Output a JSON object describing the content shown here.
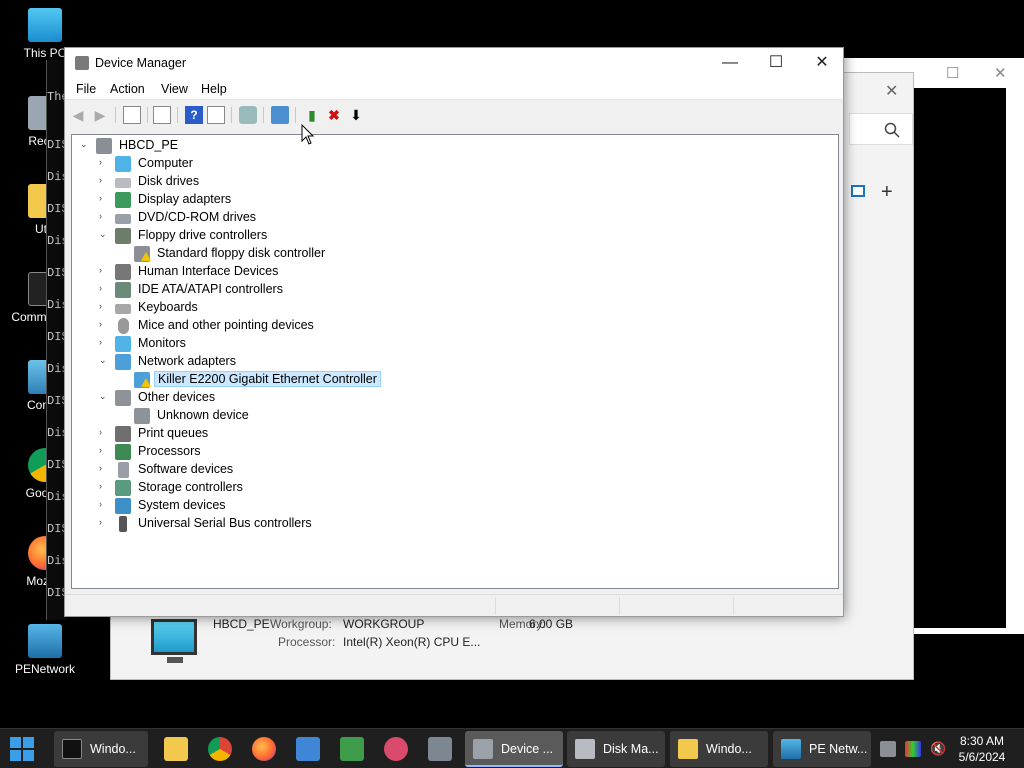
{
  "desktop": {
    "icons": [
      {
        "label": "This PC"
      },
      {
        "label": "Recyc"
      },
      {
        "label": "Utili"
      },
      {
        "label": "Comm Prom"
      },
      {
        "label": "Contro"
      },
      {
        "label": "Google"
      },
      {
        "label": "Mozilla"
      },
      {
        "label": "PENetwork"
      }
    ],
    "cmd_lines": [
      "The",
      "DIS",
      "Dis",
      "DIS",
      "Dis",
      "DIS",
      "Dis",
      "DIS",
      "Dis",
      "DIS",
      "Dis",
      "DIS",
      "Dis",
      "DIS",
      "Dis",
      "DIS"
    ]
  },
  "system_window": {
    "computer_name": "HBCD_PE",
    "workgroup_label": "Workgroup:",
    "workgroup_value": "WORKGROUP",
    "memory_label": "Memory:",
    "memory_value": "6.00 GB",
    "processor_label": "Processor:",
    "processor_value": "Intel(R) Xeon(R) CPU E..."
  },
  "device_manager": {
    "title": "Device Manager",
    "controls": {
      "minimize": "—",
      "maximize": "☐",
      "close": "✕"
    },
    "menu": [
      "File",
      "Action",
      "View",
      "Help"
    ],
    "tree": {
      "root": "HBCD_PE",
      "nodes": [
        {
          "label": "Computer",
          "expanded": false
        },
        {
          "label": "Disk drives",
          "expanded": false
        },
        {
          "label": "Display adapters",
          "expanded": false
        },
        {
          "label": "DVD/CD-ROM drives",
          "expanded": false
        },
        {
          "label": "Floppy drive controllers",
          "expanded": true,
          "children": [
            {
              "label": "Standard floppy disk controller",
              "warning": true
            }
          ]
        },
        {
          "label": "Human Interface Devices",
          "expanded": false
        },
        {
          "label": "IDE ATA/ATAPI controllers",
          "expanded": false
        },
        {
          "label": "Keyboards",
          "expanded": false
        },
        {
          "label": "Mice and other pointing devices",
          "expanded": false
        },
        {
          "label": "Monitors",
          "expanded": false
        },
        {
          "label": "Network adapters",
          "expanded": true,
          "children": [
            {
              "label": "Killer E2200 Gigabit Ethernet Controller",
              "warning": true,
              "selected": true
            }
          ]
        },
        {
          "label": "Other devices",
          "expanded": true,
          "children": [
            {
              "label": "Unknown device",
              "warning": false
            }
          ]
        },
        {
          "label": "Print queues",
          "expanded": false
        },
        {
          "label": "Processors",
          "expanded": false
        },
        {
          "label": "Software devices",
          "expanded": false
        },
        {
          "label": "Storage controllers",
          "expanded": false
        },
        {
          "label": "System devices",
          "expanded": false
        },
        {
          "label": "Universal Serial Bus controllers",
          "expanded": false
        }
      ]
    }
  },
  "taskbar": {
    "tasks": [
      {
        "label": "Windo...",
        "icon": "cmd-icon"
      },
      {
        "label": "Device ...",
        "icon": "device-manager-icon"
      },
      {
        "label": "Disk Ma...",
        "icon": "disk-management-icon"
      },
      {
        "label": "Windo...",
        "icon": "folder-icon"
      },
      {
        "label": "PE Netw...",
        "icon": "pe-network-icon"
      }
    ],
    "clock": {
      "time": "8:30 AM",
      "date": "5/6/2024"
    }
  }
}
